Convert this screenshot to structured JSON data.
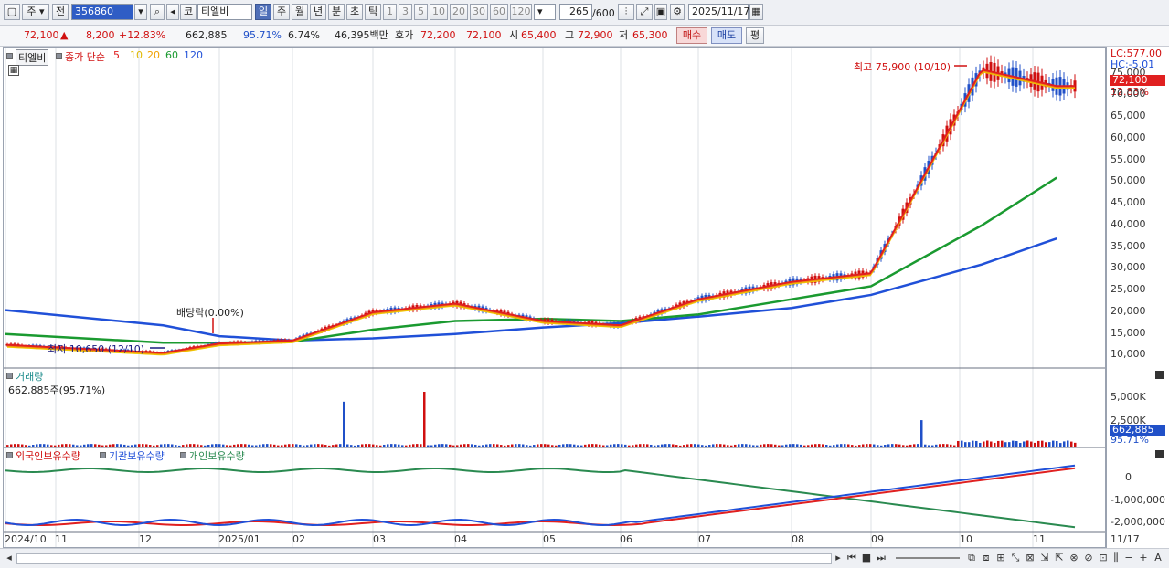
{
  "toolbar": {
    "type_label": "주",
    "prev_label": "전",
    "code_value": "356860",
    "market_label": "코",
    "name_value": "티엘비",
    "periods": [
      "일",
      "주",
      "월",
      "년",
      "분",
      "초",
      "틱"
    ],
    "active_period": "일",
    "intervals": [
      "1",
      "3",
      "5",
      "10",
      "20",
      "30",
      "60",
      "120"
    ],
    "count_value": "265",
    "count_total": "/600",
    "date_value": "2025/11/17"
  },
  "quote": {
    "price": "72,100",
    "change": "8,200",
    "change_pct": "+12.83%",
    "volume": "662,885",
    "vol_ratio": "95.71%",
    "turnover": "6.74%",
    "amount": "46,395백만",
    "ask_label": "호가",
    "ask_value": "72,200",
    "bid_value": "72,100",
    "open_label": "시",
    "open_value": "65,400",
    "high_label": "고",
    "high_value": "72,900",
    "low_label": "저",
    "low_value": "65,300",
    "buy_label": "매수",
    "sell_label": "매도",
    "eval_label": "평"
  },
  "price_panel": {
    "name": "티엘비",
    "series_label": "종가 단순",
    "ma_labels": [
      "5",
      "10",
      "20",
      "60",
      "120"
    ],
    "ma_colors": [
      "#e02020",
      "#f0c800",
      "#f09010",
      "#1a9a30",
      "#2050d8"
    ],
    "lc_label": "LC:577.00",
    "hc_label": "HC:-5.01",
    "price_tag": "72,100",
    "pct_tag": "12.83%",
    "high_annot": "최고 75,900 (10/10)",
    "low_annot": "최저 10,650 (12/10)",
    "div_annot": "배당락(0.00%)"
  },
  "volume_panel": {
    "title": "거래량",
    "value_label": "662,885주(95.71%)",
    "tag": "662,885",
    "pct": "95.71%"
  },
  "holder_panel": {
    "series": [
      "외국인보유수량",
      "기관보유수량",
      "개인보유수량"
    ],
    "colors": [
      "#e02020",
      "#2050d8",
      "#2a8a50"
    ]
  },
  "x_labels": [
    "2024/10",
    "11",
    "12",
    "2025/01",
    "02",
    "03",
    "04",
    "05",
    "06",
    "07",
    "08",
    "09",
    "10",
    "11"
  ],
  "x_end": "11/17",
  "chart_data": {
    "type": "line",
    "price": {
      "x": [
        "2024-10",
        "2024-12-10",
        "2025-01",
        "2025-02",
        "2025-03",
        "2025-04",
        "2025-05",
        "2025-06",
        "2025-07",
        "2025-08",
        "2025-09",
        "2025-10-10",
        "2025-11-17"
      ],
      "close": [
        12500,
        10650,
        12800,
        13500,
        20000,
        22000,
        18000,
        17000,
        23000,
        27000,
        29000,
        75900,
        72100
      ],
      "ma120": [
        20500,
        17000,
        14500,
        13500,
        14000,
        15000,
        16500,
        17500,
        19000,
        21000,
        24000,
        31000,
        37000
      ],
      "ma60": [
        15000,
        13000,
        13000,
        13200,
        16000,
        18000,
        18500,
        18000,
        19500,
        23000,
        26000,
        40000,
        51000
      ],
      "yticks": [
        "75,000",
        "70,000",
        "65,000",
        "60,000",
        "55,000",
        "50,000",
        "45,000",
        "40,000",
        "35,000",
        "30,000",
        "25,000",
        "20,000",
        "15,000",
        "10,000"
      ],
      "ylim": [
        8000,
        77000
      ]
    },
    "volume": {
      "yticks": [
        "5,000K",
        "2,500K"
      ],
      "peaks": [
        {
          "x": "2025-02-20",
          "value": 6800
        },
        {
          "x": "2025-03-20",
          "value": 8300
        },
        {
          "x": "2025-09-18",
          "value": 4000
        }
      ],
      "last": 662885
    },
    "holders": {
      "yticks": [
        "0",
        "-1,000,000",
        "-2,000,000"
      ]
    }
  }
}
